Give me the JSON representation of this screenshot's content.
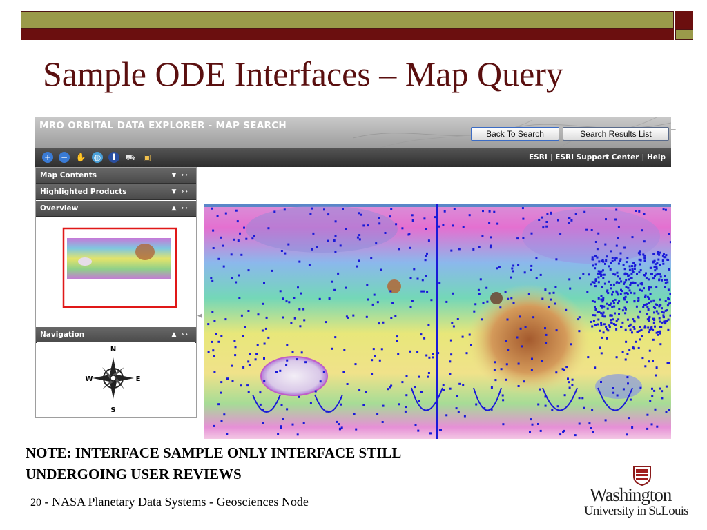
{
  "slide": {
    "title": "Sample ODE Interfaces – Map Query",
    "note_line1": "NOTE: INTERFACE SAMPLE ONLY INTERFACE STILL",
    "note_line2": "UNDERGOING USER REVIEWS",
    "footer_number": "20",
    "footer_text": "- NASA Planetary Data Systems - Geosciences Node",
    "logo_line1": "Washington",
    "logo_line2": "University in St.Louis"
  },
  "app": {
    "title": "MRO ORBITAL DATA EXPLORER - MAP SEARCH",
    "back_button": "Back To Search",
    "results_button": "Search Results List",
    "trailing_dash": "–",
    "toolbar_icons": [
      "zoom-in-icon",
      "zoom-out-icon",
      "pan-hand-icon",
      "full-extent-globe-icon",
      "identify-info-icon",
      "measure-icon",
      "layers-icon"
    ],
    "links": [
      "ESRI",
      "ESRI Support Center",
      "Help"
    ],
    "panels": {
      "map_contents": "Map Contents",
      "highlighted_products": "Highlighted Products",
      "overview": "Overview",
      "navigation": "Navigation"
    },
    "compass": {
      "n": "N",
      "s": "S",
      "e": "E",
      "w": "W"
    }
  },
  "colors": {
    "slide_title": "#5a0f0f",
    "bar_olive": "#9a9a4a",
    "bar_maroon": "#6b0f0f",
    "footprints": "#1a1ad8",
    "overview_frame": "#e01818"
  }
}
